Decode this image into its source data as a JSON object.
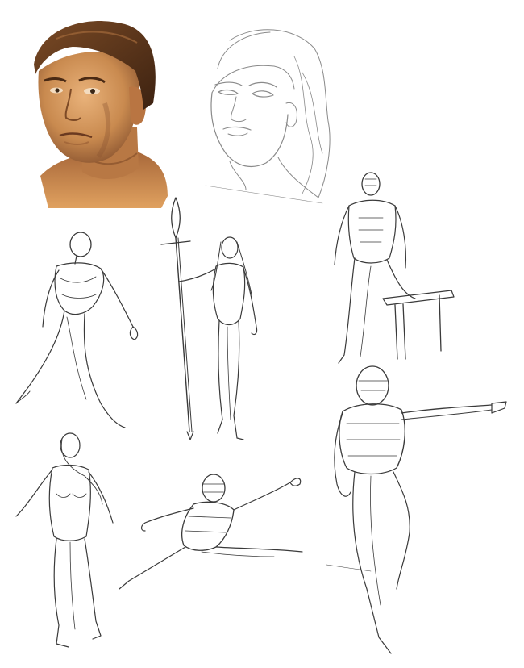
{
  "sheet": {
    "background": "#ffffff",
    "medium": "figure-study-sketches"
  },
  "colors": {
    "pencil": "#3a3a3a",
    "pencil_light": "#8a8a8a",
    "skin_light": "#e9b27a",
    "skin_mid": "#c98a4f",
    "skin_shadow": "#8a5430",
    "hair": "#6b3f1f",
    "hair_dark": "#3d2211"
  },
  "sketches": [
    {
      "id": "painted-male-head",
      "kind": "painted portrait"
    },
    {
      "id": "female-head-lineart",
      "kind": "line drawing portrait"
    },
    {
      "id": "striding-figure",
      "kind": "gesture sketch"
    },
    {
      "id": "elf-with-spear",
      "kind": "figure line drawing"
    },
    {
      "id": "seated-mannequin-on-bench",
      "kind": "anatomy sketch"
    },
    {
      "id": "pointing-figure",
      "kind": "construction sketch"
    },
    {
      "id": "standing-female-figure",
      "kind": "gesture sketch"
    },
    {
      "id": "leaping-figure",
      "kind": "construction sketch"
    }
  ]
}
